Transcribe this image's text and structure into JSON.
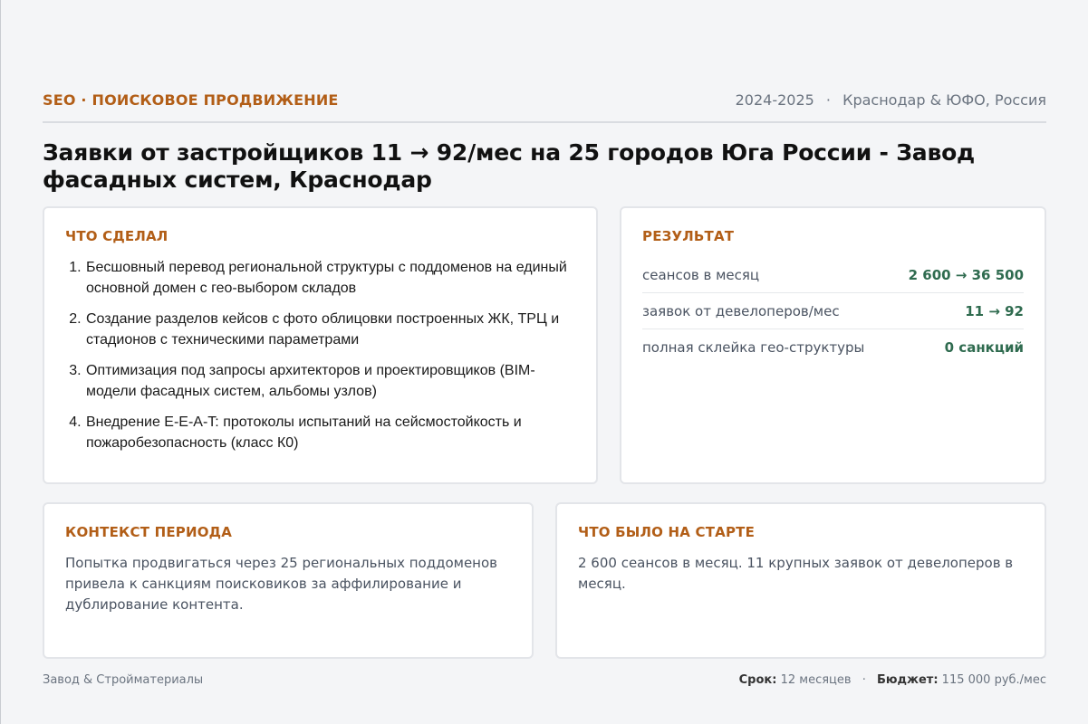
{
  "header": {
    "kicker": "SEO · ПОИСКОВОЕ ПРОДВИЖЕНИЕ",
    "years": "2024-2025",
    "separator": "·",
    "location": "Краснодар & ЮФО, Россия"
  },
  "title": "Заявки от застройщиков 11 → 92/мес на 25 городов Юга России - Завод фасадных систем, Краснодар",
  "did": {
    "title": "ЧТО СДЕЛАЛ",
    "items": [
      "Бесшовный перевод региональной структуры с поддоменов на единый основной домен с гео-выбором складов",
      "Создание разделов кейсов с фото облицовки построенных ЖК, ТРЦ и стадионов с техническими параметрами",
      "Оптимизация под запросы архитекторов и проектировщиков (BIM-модели фасадных систем, альбомы узлов)",
      "Внедрение E-E-A-T: протоколы испытаний на сейсмостойкость и пожаробезопасность (класс К0)"
    ]
  },
  "result": {
    "title": "РЕЗУЛЬТАТ",
    "metrics": [
      {
        "label": "сеансов в месяц",
        "value": "2 600 → 36 500"
      },
      {
        "label": "заявок от девелоперов/мес",
        "value": "11 → 92"
      },
      {
        "label": "полная склейка гео-структуры",
        "value": "0 санкций"
      }
    ]
  },
  "context": {
    "title": "КОНТЕКСТ ПЕРИОДА",
    "text": "Попытка продвигаться через 25 региональных поддоменов привела к санкциям поисковиков за аффилирование и дублирование контента."
  },
  "start": {
    "title": "ЧТО БЫЛО НА СТАРТЕ",
    "text": "2 600 сеансов в месяц. 11 крупных заявок от девелоперов в месяц."
  },
  "footer": {
    "category": "Завод & Стройматериалы",
    "term_label": "Срок:",
    "term_value": "12 месяцев",
    "separator": "·",
    "budget_label": "Бюджет:",
    "budget_value": "115 000 руб./мес"
  }
}
